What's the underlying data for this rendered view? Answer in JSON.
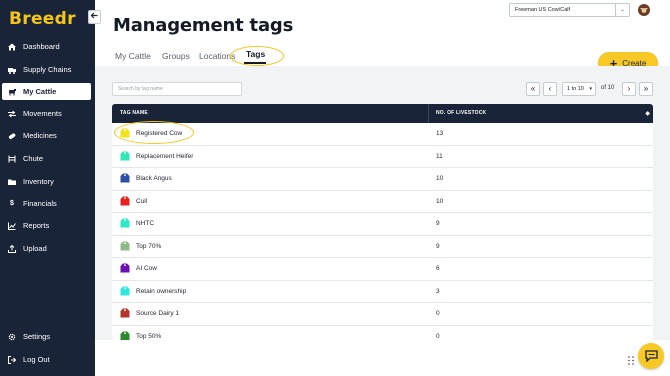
{
  "app": {
    "logo_text": "Breedr"
  },
  "sidebar": {
    "collapse_icon": "arrow-left-icon",
    "items": [
      {
        "label": "Dashboard",
        "icon": "home-icon"
      },
      {
        "label": "Supply Chains",
        "icon": "truck-icon"
      },
      {
        "label": "My Cattle",
        "icon": "cow-icon",
        "active": true
      },
      {
        "label": "Movements",
        "icon": "arrows-icon"
      },
      {
        "label": "Medicines",
        "icon": "pill-icon"
      },
      {
        "label": "Chute",
        "icon": "chute-icon"
      },
      {
        "label": "Inventory",
        "icon": "folder-icon"
      },
      {
        "label": "Financials",
        "icon": "dollar-icon"
      },
      {
        "label": "Reports",
        "icon": "chart-icon"
      },
      {
        "label": "Upload",
        "icon": "upload-icon"
      }
    ],
    "footer": [
      {
        "label": "Settings",
        "icon": "gear-icon"
      },
      {
        "label": "Log Out",
        "icon": "logout-icon"
      }
    ]
  },
  "header": {
    "farm_select": "Freeman US Cow/Calf",
    "page_title": "Management tags"
  },
  "tabs": [
    {
      "label": "My Cattle"
    },
    {
      "label": "Groups"
    },
    {
      "label": "Locations"
    },
    {
      "label": "Tags",
      "active": true
    }
  ],
  "create_button": {
    "label": "Create"
  },
  "search": {
    "placeholder": "Search by tag name"
  },
  "pagination": {
    "first": "«",
    "prev": "‹",
    "range": "1 to 10",
    "of": "of 10",
    "next": "›",
    "last": "»"
  },
  "table": {
    "columns": [
      "TAG NAME",
      "NO. OF LIVESTOCK"
    ],
    "rows": [
      {
        "name": "Registered Cow",
        "count": "13",
        "color": "#f2e21a"
      },
      {
        "name": "Replacement Heifer",
        "count": "11",
        "color": "#2ee8b6"
      },
      {
        "name": "Black Angus",
        "count": "10",
        "color": "#2e4fa8"
      },
      {
        "name": "Cull",
        "count": "10",
        "color": "#e8201c"
      },
      {
        "name": "NHTC",
        "count": "9",
        "color": "#2ee8c8"
      },
      {
        "name": "Top 70%",
        "count": "9",
        "color": "#8fb887"
      },
      {
        "name": "AI Cow",
        "count": "6",
        "color": "#6a12b0"
      },
      {
        "name": "Retain ownership",
        "count": "3",
        "color": "#2ee8e0"
      },
      {
        "name": "Source Dairy 1",
        "count": "0",
        "color": "#b5332a"
      },
      {
        "name": "Top 50%",
        "count": "0",
        "color": "#2c8a2c"
      }
    ]
  },
  "colors": {
    "sidebar_bg": "#1a2438",
    "accent": "#f7c826",
    "table_header": "#1a2438"
  }
}
